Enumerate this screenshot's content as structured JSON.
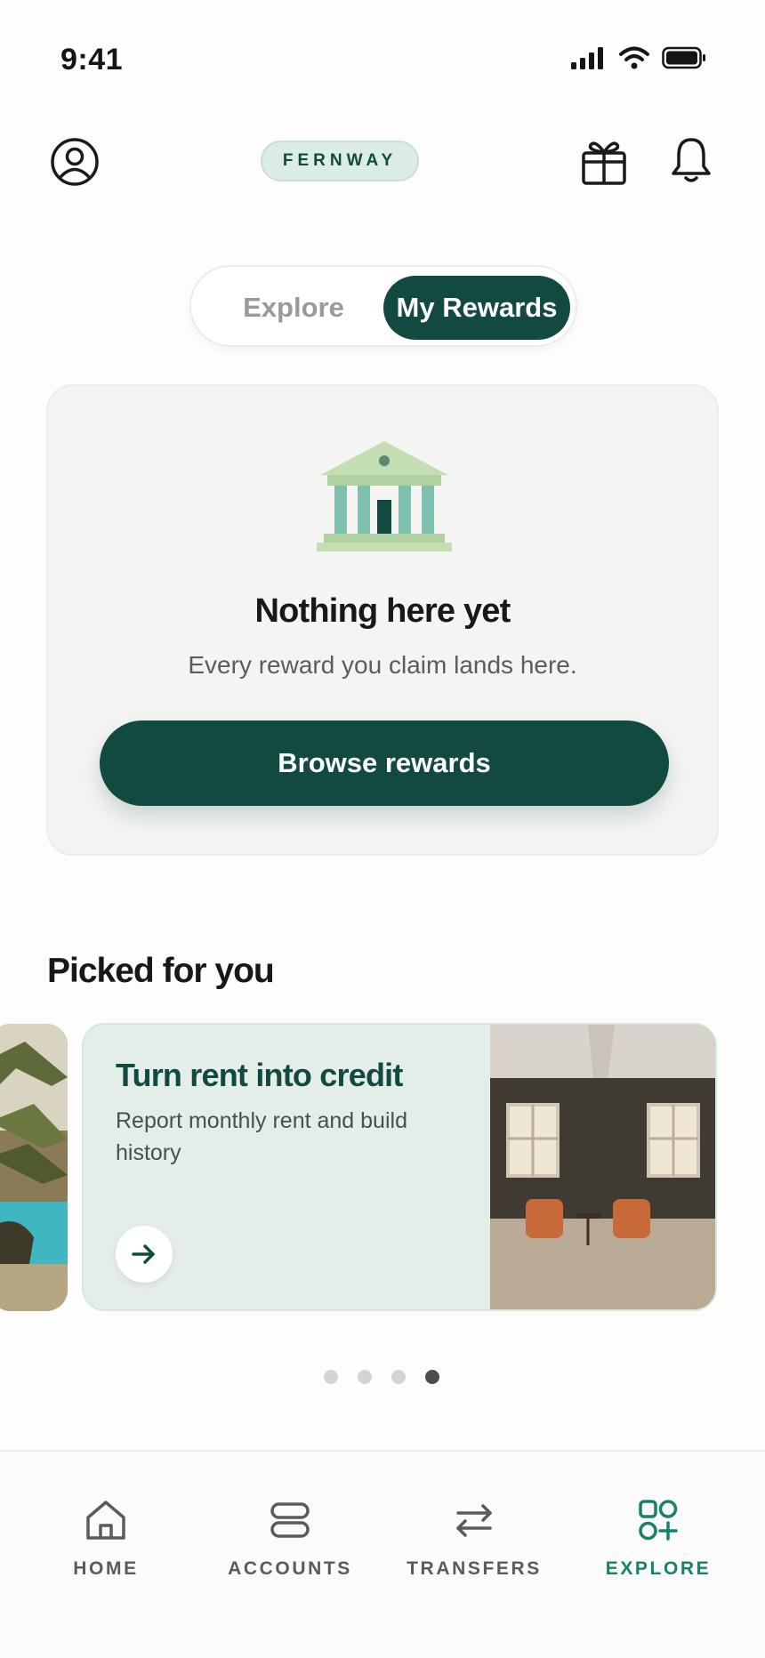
{
  "status_bar": {
    "time": "9:41"
  },
  "header": {
    "brand": "FERNWAY"
  },
  "segmented_control": {
    "options": [
      "Explore",
      "My Rewards"
    ],
    "selected": "My Rewards"
  },
  "empty_state": {
    "title": "Nothing here yet",
    "subtitle": "Every reward you claim lands here.",
    "button_label": "Browse rewards"
  },
  "picked_for_you": {
    "title": "Picked for you",
    "cards": [
      {
        "title": "Turn rent into credit",
        "description": "Report monthly rent and build history"
      }
    ],
    "pagination": {
      "total": 4,
      "active": 4
    }
  },
  "bottom_nav": {
    "items": [
      {
        "label": "HOME",
        "icon": "home-icon"
      },
      {
        "label": "ACCOUNTS",
        "icon": "accounts-icon"
      },
      {
        "label": "TRANSFERS",
        "icon": "transfers-icon"
      },
      {
        "label": "EXPLORE",
        "icon": "explore-icon"
      }
    ],
    "active": "EXPLORE"
  },
  "colors": {
    "primary": "#124a41",
    "accent": "#17826a",
    "brand_pill": "#dcede6"
  }
}
